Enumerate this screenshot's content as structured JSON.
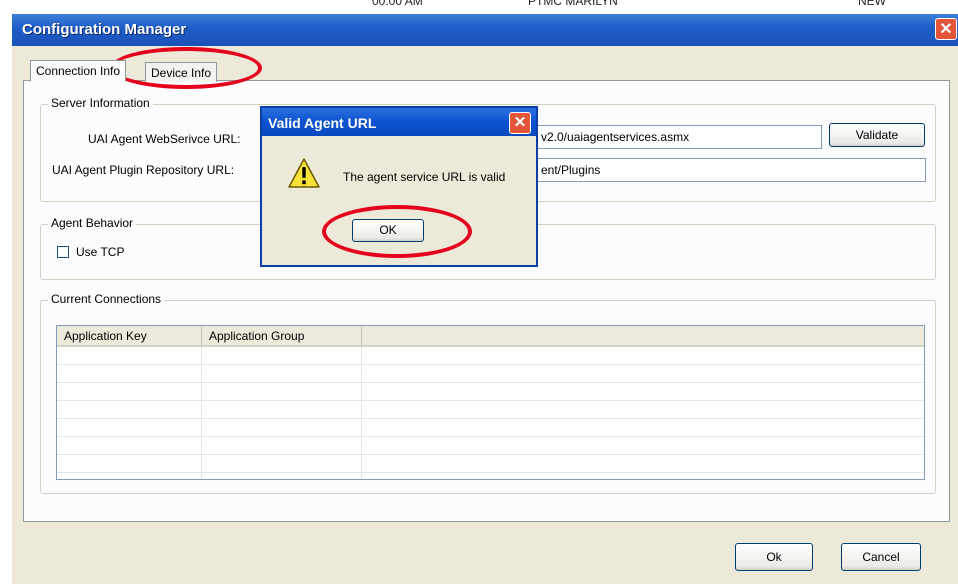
{
  "background_window": {
    "fragments": [
      "00:00 AM",
      "PTMC MARILYN",
      "NEW"
    ]
  },
  "window": {
    "title": "Configuration Manager",
    "close_glyph": "✕"
  },
  "tabs": [
    {
      "label": "Connection Info",
      "selected": true
    },
    {
      "label": "Device Info",
      "selected": false
    }
  ],
  "server_info": {
    "group_label": "Server Information",
    "webservice_label": "UAI Agent WebSerivce URL:",
    "webservice_value": "v2.0/uaiagentservices.asmx",
    "validate_label": "Validate",
    "plugin_label": "UAI Agent Plugin Repository URL:",
    "plugin_value": "ent/Plugins"
  },
  "agent_behavior": {
    "group_label": "Agent Behavior",
    "use_tcp_label": "Use TCP",
    "use_tcp_checked": false
  },
  "connections": {
    "group_label": "Current Connections",
    "columns": [
      "Application Key",
      "Application Group"
    ],
    "rows": []
  },
  "footer": {
    "ok_label": "Ok",
    "cancel_label": "Cancel"
  },
  "dialog": {
    "title": "Valid Agent URL",
    "message": "The agent service URL is valid",
    "ok_label": "OK",
    "icon": "warning-icon"
  },
  "colors": {
    "titlebar": "#1f5fc9",
    "annotation": "#e5001b",
    "dialog_face": "#ece9d8"
  }
}
